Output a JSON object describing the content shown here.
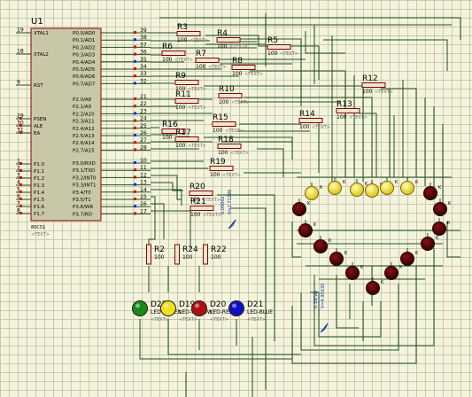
{
  "microcontroller": {
    "ref": "U1",
    "part": "80C51",
    "text_tag": "<TEXT>",
    "left_pins": [
      {
        "num": "19",
        "name": "XTAL1"
      },
      {
        "num": "18",
        "name": "XTAL2"
      },
      {
        "num": "9",
        "name": "RST"
      },
      {
        "num": "29",
        "name": "PSEN"
      },
      {
        "num": "30",
        "name": "ALE"
      },
      {
        "num": "31",
        "name": "EA"
      },
      {
        "num": "1",
        "name": "P1.0"
      },
      {
        "num": "2",
        "name": "P1.1"
      },
      {
        "num": "3",
        "name": "P1.2"
      },
      {
        "num": "4",
        "name": "P1.3"
      },
      {
        "num": "5",
        "name": "P1.4"
      },
      {
        "num": "6",
        "name": "P1.5"
      },
      {
        "num": "7",
        "name": "P1.6"
      },
      {
        "num": "8",
        "name": "P1.7"
      }
    ],
    "right_pins": [
      {
        "num": "39",
        "name": "P0.0/AD0"
      },
      {
        "num": "38",
        "name": "P0.1/AD1"
      },
      {
        "num": "37",
        "name": "P0.2/AD2"
      },
      {
        "num": "36",
        "name": "P0.3/AD3"
      },
      {
        "num": "35",
        "name": "P0.4/AD4"
      },
      {
        "num": "34",
        "name": "P0.5/AD5"
      },
      {
        "num": "33",
        "name": "P0.6/AD6"
      },
      {
        "num": "32",
        "name": "P0.7/AD7"
      },
      {
        "num": "21",
        "name": "P2.0/A8"
      },
      {
        "num": "22",
        "name": "P2.1/A9"
      },
      {
        "num": "23",
        "name": "P2.2/A10"
      },
      {
        "num": "24",
        "name": "P2.3/A11"
      },
      {
        "num": "25",
        "name": "P2.4/A12"
      },
      {
        "num": "26",
        "name": "P2.5/A13"
      },
      {
        "num": "27",
        "name": "P2.6/A14"
      },
      {
        "num": "28",
        "name": "P2.7/A15"
      },
      {
        "num": "10",
        "name": "P3.0/RXD"
      },
      {
        "num": "11",
        "name": "P3.1/TXD"
      },
      {
        "num": "12",
        "name": "P3.2/INT0"
      },
      {
        "num": "13",
        "name": "P3.3/INT1"
      },
      {
        "num": "14",
        "name": "P3.4/T0"
      },
      {
        "num": "15",
        "name": "P3.5/T1"
      },
      {
        "num": "16",
        "name": "P3.6/WR"
      },
      {
        "num": "17",
        "name": "P3.7/RD"
      }
    ]
  },
  "resistors": [
    {
      "ref": "R3",
      "value": "100"
    },
    {
      "ref": "R4",
      "value": "100"
    },
    {
      "ref": "R5",
      "value": "100"
    },
    {
      "ref": "R6",
      "value": "100"
    },
    {
      "ref": "R7",
      "value": "100"
    },
    {
      "ref": "R8",
      "value": "100"
    },
    {
      "ref": "R9",
      "value": "100"
    },
    {
      "ref": "R10",
      "value": "100"
    },
    {
      "ref": "R11",
      "value": "100"
    },
    {
      "ref": "R12",
      "value": "100"
    },
    {
      "ref": "R13",
      "value": "100"
    },
    {
      "ref": "R14",
      "value": "100"
    },
    {
      "ref": "R15",
      "value": "100"
    },
    {
      "ref": "R16",
      "value": "100"
    },
    {
      "ref": "R17",
      "value": "100"
    },
    {
      "ref": "R18",
      "value": "100"
    },
    {
      "ref": "R19",
      "value": "100"
    },
    {
      "ref": "R20",
      "value": "100"
    },
    {
      "ref": "R21",
      "value": "100"
    },
    {
      "ref": "R2",
      "value": "100"
    },
    {
      "ref": "R24",
      "value": "100"
    },
    {
      "ref": "R22",
      "value": "100"
    }
  ],
  "indicator_leds": [
    {
      "ref": "D22",
      "label": "LED-GREEN",
      "color": "#1a8a1a"
    },
    {
      "ref": "D19",
      "label": "LED-YELLOW",
      "color": "#f0e020"
    },
    {
      "ref": "D20",
      "label": "LED-RED",
      "color": "#b01010"
    },
    {
      "ref": "D21",
      "label": "LED-BLUE",
      "color": "#1010c0"
    }
  ],
  "probes": [
    {
      "text": "0.00002",
      "sub": "V=2.71296"
    },
    {
      "text": "0.16(W)",
      "sub": "V=4.95630"
    }
  ],
  "ring_led_colors": {
    "on": "#f0e020",
    "off": "#5a0606"
  },
  "text_tag": "<TEXT>",
  "colors": {
    "wire": "#1f4f1f",
    "component": "#8b0000",
    "chip_fill": "#c8c8a8",
    "pin_marker_red": "#e00000",
    "pin_marker_blue": "#1030e0"
  }
}
